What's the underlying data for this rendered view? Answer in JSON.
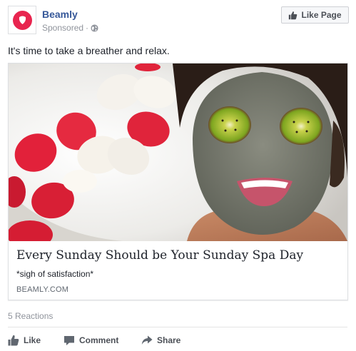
{
  "post": {
    "page_name": "Beamly",
    "sponsored_label": "Sponsored",
    "separator": "·",
    "like_page_label": "Like Page",
    "message": "It's time to take a breather and relax."
  },
  "attachment": {
    "headline": "Every Sunday Should be Your Sunday Spa Day",
    "description": "*sigh of satisfaction*",
    "domain": "BEAMLY.COM"
  },
  "reactions": {
    "count_text": "5 Reactions"
  },
  "actions": [
    {
      "label": "Like",
      "icon": "thumbs-up-icon"
    },
    {
      "label": "Comment",
      "icon": "comment-icon"
    },
    {
      "label": "Share",
      "icon": "share-icon"
    }
  ],
  "colors": {
    "brand": "#e8254f",
    "link": "#365899",
    "muted": "#90949c",
    "action_text": "#4b4f56"
  }
}
